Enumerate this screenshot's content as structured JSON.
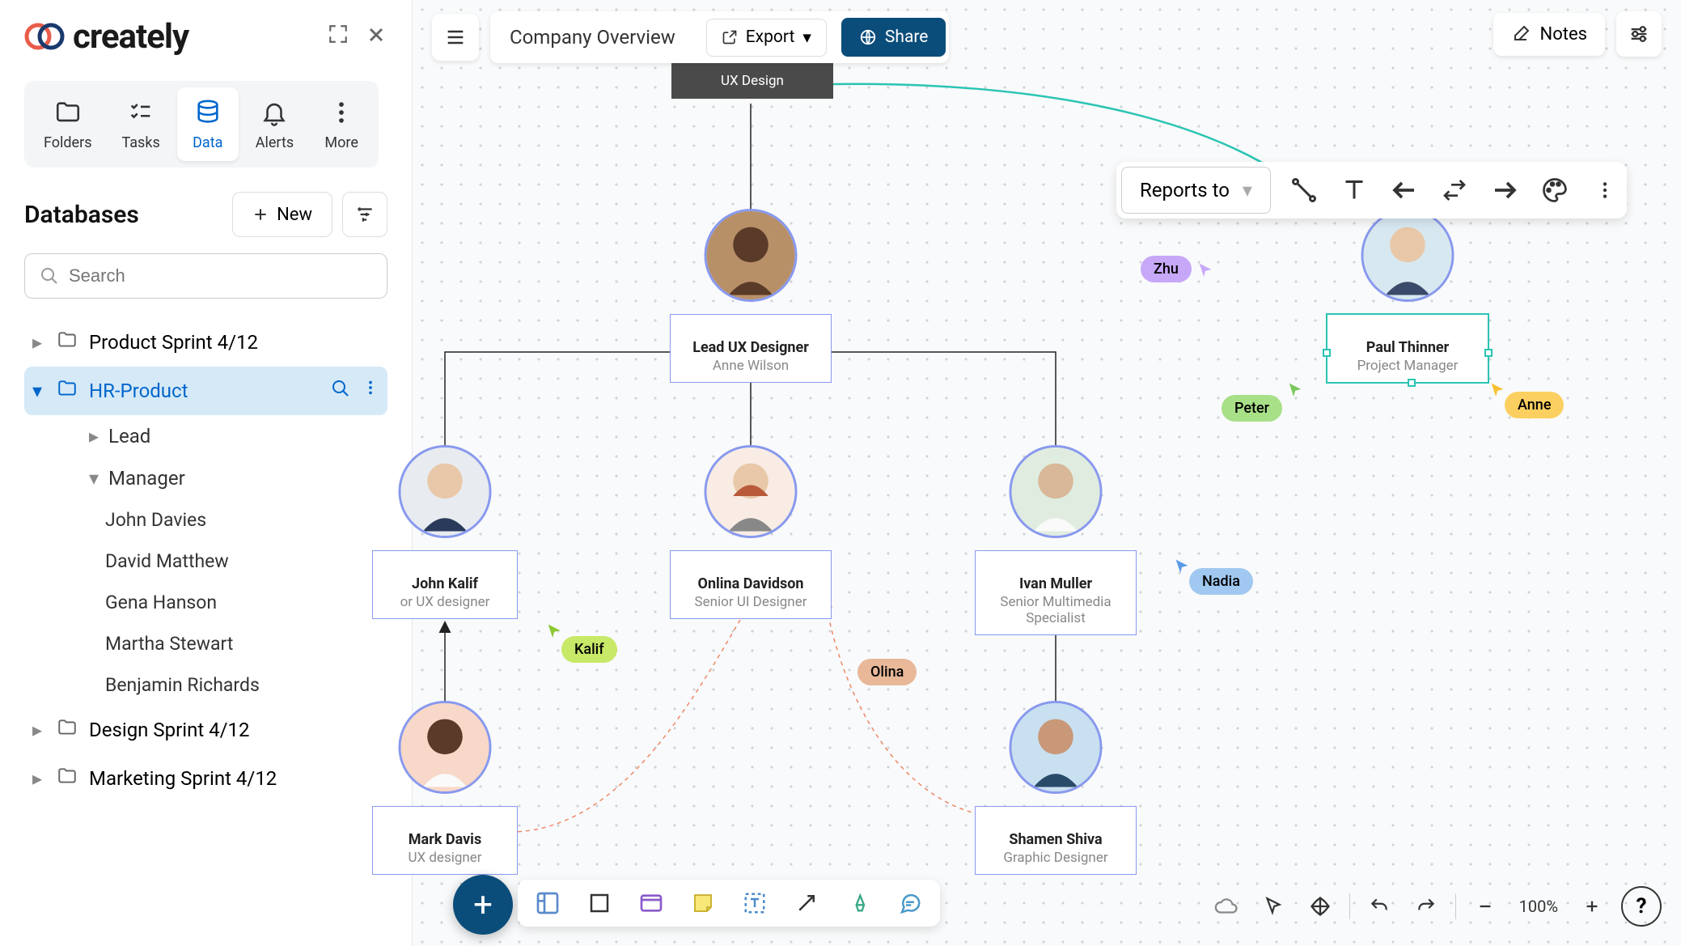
{
  "brand": "creately",
  "sidebar": {
    "tabs": [
      "Folders",
      "Tasks",
      "Data",
      "Alerts",
      "More"
    ],
    "active_tab": "Data",
    "section_title": "Databases",
    "new_label": "New",
    "search_placeholder": "Search",
    "tree": [
      {
        "label": "Product Sprint 4/12",
        "expanded": false
      },
      {
        "label": "HR-Product",
        "expanded": true,
        "selected": true,
        "children": [
          {
            "label": "Lead",
            "expanded": false
          },
          {
            "label": "Manager",
            "expanded": true,
            "children": [
              "John Davies",
              "David Matthew",
              "Gena Hanson",
              "Martha Stewart",
              "Benjamin Richards"
            ]
          }
        ]
      },
      {
        "label": "Design Sprint 4/12",
        "expanded": false
      },
      {
        "label": "Marketing Sprint 4/12",
        "expanded": false
      }
    ]
  },
  "topbar": {
    "doc_title": "Company Overview",
    "export_label": "Export",
    "share_label": "Share",
    "notes_label": "Notes"
  },
  "line_toolbar": {
    "relation_label": "Reports to"
  },
  "banner": "UX Design",
  "nodes": {
    "anne": {
      "name": "Anne Wilson",
      "role": "Lead UX Designer"
    },
    "paul": {
      "name": "Paul Thinner",
      "role": "Project Manager"
    },
    "john": {
      "name": "John Kalif",
      "role": "or UX designer"
    },
    "onlina": {
      "name": "Onlina Davidson",
      "role": "Senior UI Designer"
    },
    "ivan": {
      "name": "Ivan Muller",
      "role": "Senior Multimedia Specialist"
    },
    "mark": {
      "name": "Mark Davis",
      "role": "UX designer"
    },
    "shamen": {
      "name": "Shamen Shiva",
      "role": "Graphic Designer"
    }
  },
  "cursors": {
    "zhu": "Zhu",
    "peter": "Peter",
    "anne_c": "Anne",
    "nadia": "Nadia",
    "kalif": "Kalif",
    "olina": "Olina"
  },
  "view": {
    "zoom": "100%"
  }
}
